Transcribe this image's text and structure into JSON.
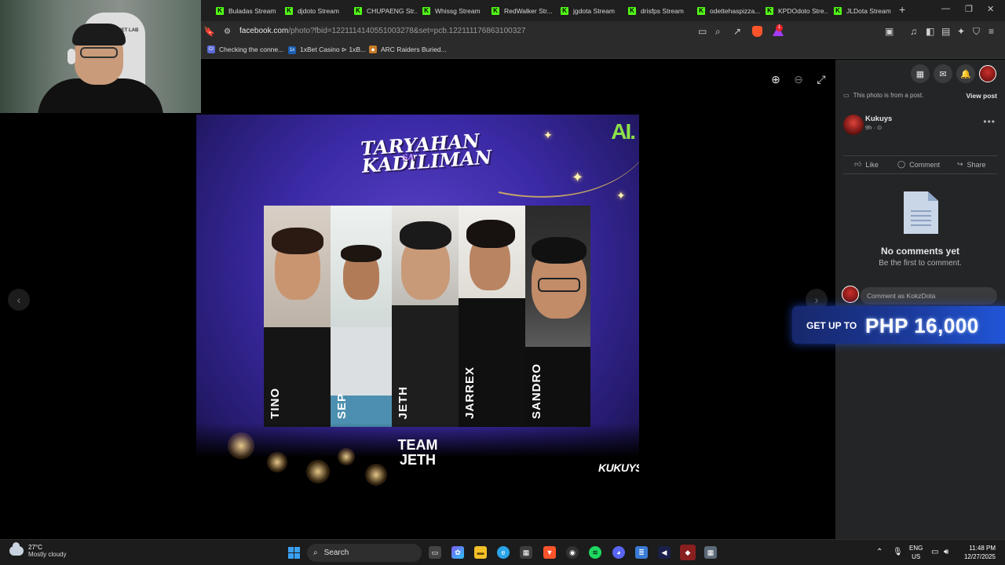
{
  "browser": {
    "tabs": [
      {
        "label": "Buladas Stream"
      },
      {
        "label": "djdoto Stream"
      },
      {
        "label": "CHUPAENG Str..."
      },
      {
        "label": "Whissg Stream"
      },
      {
        "label": "RedWalker Str..."
      },
      {
        "label": "jgdota Stream"
      },
      {
        "label": "drisfps Stream"
      },
      {
        "label": "odettehaspizza..."
      },
      {
        "label": "KPDOdoto Stre..."
      },
      {
        "label": "JLDota Stream"
      }
    ],
    "url_host": "facebook.com",
    "url_path": "/photo?fbid=1221114140551003278&set=pcb.122111176863100327",
    "brave_badge": "1",
    "bookmarks": [
      {
        "label": "Checking the conne...",
        "icon": "Cr",
        "color": "#5b6bd6"
      },
      {
        "label": "1xBet Casino ⊳ 1xB...",
        "icon": "1x",
        "color": "#1a5fb4"
      },
      {
        "label": "ARC Raiders Buried...",
        "icon": "◆",
        "color": "#c77b27"
      }
    ]
  },
  "webcam": {
    "chair_text": "SECRET LAB"
  },
  "poster": {
    "title_line1": "TARYAHAN",
    "title_line2": "KADILIMAN",
    "title_sub": "SA",
    "brand_logo": "AI.",
    "members": [
      {
        "name": "TINO"
      },
      {
        "name": "SEP"
      },
      {
        "name": "JETH"
      },
      {
        "name": "JARREX"
      },
      {
        "name": "SANDRO"
      }
    ],
    "team_line1": "TEAM",
    "team_line2": "JETH",
    "sponsor_logo": "KUKUYS"
  },
  "sidebar": {
    "from_post": "This photo is from a post.",
    "view_post": "View post",
    "author": "Kukuys",
    "time": "9h · ⊙",
    "like": "Like",
    "comment": "Comment",
    "share": "Share",
    "no_comments_title": "No comments yet",
    "no_comments_sub": "Be the first to comment.",
    "comment_placeholder": "Comment as KokzDota"
  },
  "ad": {
    "small": "GET UP TO",
    "big": "PHP 16,000"
  },
  "taskbar": {
    "temp": "27°C",
    "weather": "Mostly cloudy",
    "search": "Search",
    "lang1": "ENG",
    "lang2": "US",
    "time": "11:48 PM",
    "date": "12/27/2025"
  }
}
